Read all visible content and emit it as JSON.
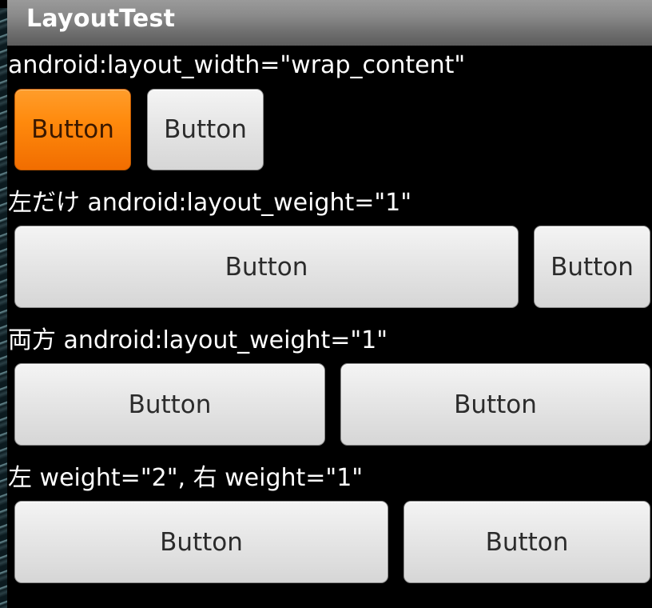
{
  "app": {
    "title": "LayoutTest"
  },
  "sections": [
    {
      "caption": "android:layout_width=\"wrap_content\"",
      "buttons": [
        "Button",
        "Button"
      ]
    },
    {
      "caption": "左だけ android:layout_weight=\"1\"",
      "buttons": [
        "Button",
        "Button"
      ]
    },
    {
      "caption": "両方 android:layout_weight=\"1\"",
      "buttons": [
        "Button",
        "Button"
      ]
    },
    {
      "caption": "左 weight=\"2\", 右 weight=\"1\"",
      "buttons": [
        "Button",
        "Button"
      ]
    }
  ],
  "colors": {
    "focused_button": "#ff8a0d",
    "button_face": "#e6e6e6",
    "background": "#000000",
    "title_bar": "#7a7a7a"
  }
}
